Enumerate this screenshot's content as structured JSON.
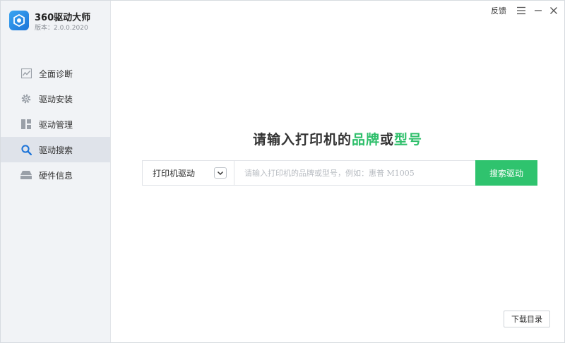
{
  "app": {
    "title": "360驱动大师",
    "version": "版本：2.0.0.2020"
  },
  "topbar": {
    "feedback_label": "反馈"
  },
  "sidebar": {
    "items": [
      {
        "label": "全面诊断",
        "icon": "chart-icon",
        "active": false
      },
      {
        "label": "驱动安装",
        "icon": "gear-icon",
        "active": false
      },
      {
        "label": "驱动管理",
        "icon": "grid-icon",
        "active": false
      },
      {
        "label": "驱动搜索",
        "icon": "search-icon",
        "active": true
      },
      {
        "label": "硬件信息",
        "icon": "hardware-icon",
        "active": false
      }
    ]
  },
  "main": {
    "headline_prefix": "请输入打印机的",
    "headline_brand": "品牌",
    "headline_or": "或",
    "headline_model": "型号",
    "search": {
      "type_selected": "打印机驱动",
      "placeholder": "请输入打印机的品牌或型号，例如：惠普 M1005",
      "value": "",
      "button_label": "搜索驱动"
    },
    "catalog_button_label": "下载目录"
  },
  "colors": {
    "accent_green": "#2fc36e",
    "sidebar_bg": "#f1f3f6",
    "active_item_bg": "#dfe3ea",
    "logo_blue": "#1d74d8"
  }
}
